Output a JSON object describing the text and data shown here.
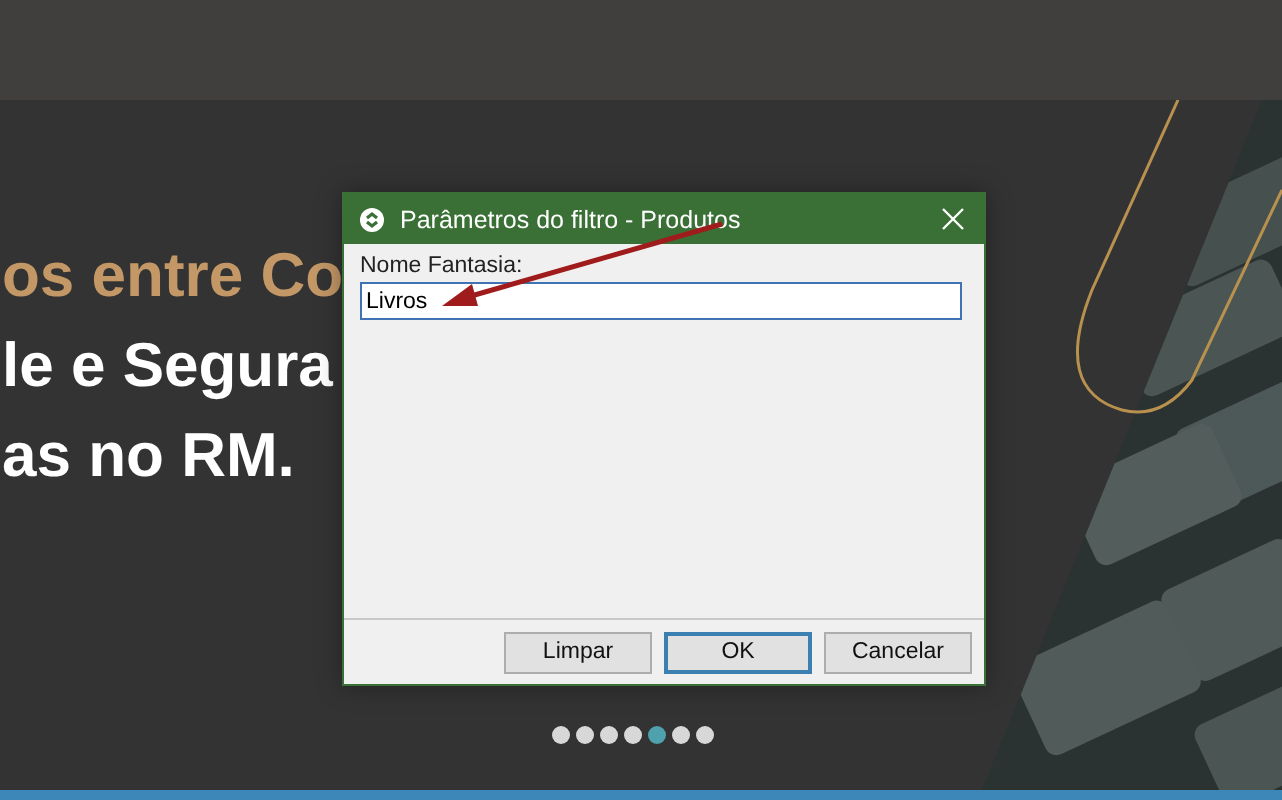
{
  "hero": {
    "lines": [
      {
        "text": "os entre Co",
        "kind": "accent"
      },
      {
        "text": "le e Segura",
        "kind": "plain"
      },
      {
        "text": "as no RM.",
        "kind": "plain"
      }
    ]
  },
  "carousel": {
    "dots": [
      {
        "selected": false
      },
      {
        "selected": false
      },
      {
        "selected": false
      },
      {
        "selected": false
      },
      {
        "selected": true
      },
      {
        "selected": false
      },
      {
        "selected": false
      }
    ]
  },
  "dialog": {
    "title": "Parâmetros do filtro - Produtos",
    "field": {
      "label": "Nome Fantasia:",
      "value": "Livros",
      "focused": true
    },
    "buttons": [
      {
        "label": "Limpar",
        "default": false
      },
      {
        "label": "OK",
        "default": true
      },
      {
        "label": "Cancelar",
        "default": false
      }
    ]
  }
}
